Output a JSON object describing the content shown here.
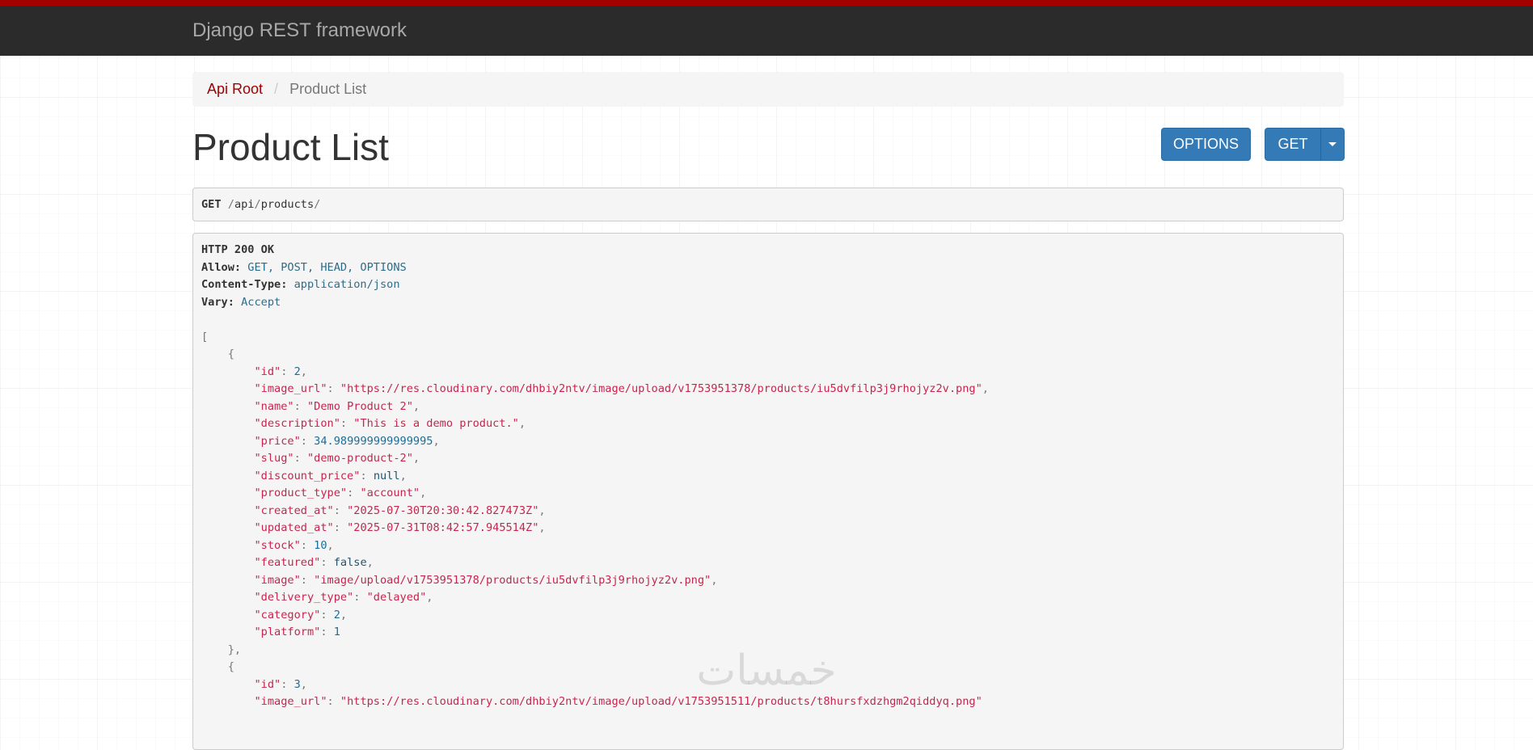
{
  "navbar": {
    "brand": "Django REST framework"
  },
  "breadcrumb": {
    "root": "Api Root",
    "separator": "/",
    "current": "Product List"
  },
  "page": {
    "title": "Product List"
  },
  "buttons": {
    "options": "OPTIONS",
    "get": "GET"
  },
  "request": {
    "method": "GET",
    "path_parts": [
      "/",
      "api",
      "/",
      "products",
      "/"
    ]
  },
  "response": {
    "status": "HTTP 200 OK",
    "headers": [
      {
        "name": "Allow:",
        "value": "GET, POST, HEAD, OPTIONS"
      },
      {
        "name": "Content-Type:",
        "value": "application/json"
      },
      {
        "name": "Vary:",
        "value": "Accept"
      }
    ],
    "items": [
      {
        "fields": [
          {
            "key": "id",
            "value": "2",
            "type": "num"
          },
          {
            "key": "image_url",
            "value": "\"https://res.cloudinary.com/dhbiy2ntv/image/upload/v1753951378/products/iu5dvfilp3j9rhojyz2v.png\"",
            "type": "str"
          },
          {
            "key": "name",
            "value": "\"Demo Product 2\"",
            "type": "str"
          },
          {
            "key": "description",
            "value": "\"This is a demo product.\"",
            "type": "str"
          },
          {
            "key": "price",
            "value": "34.989999999999995",
            "type": "num"
          },
          {
            "key": "slug",
            "value": "\"demo-product-2\"",
            "type": "str"
          },
          {
            "key": "discount_price",
            "value": "null",
            "type": "lit"
          },
          {
            "key": "product_type",
            "value": "\"account\"",
            "type": "str"
          },
          {
            "key": "created_at",
            "value": "\"2025-07-30T20:30:42.827473Z\"",
            "type": "str"
          },
          {
            "key": "updated_at",
            "value": "\"2025-07-31T08:42:57.945514Z\"",
            "type": "str"
          },
          {
            "key": "stock",
            "value": "10",
            "type": "num"
          },
          {
            "key": "featured",
            "value": "false",
            "type": "lit"
          },
          {
            "key": "image",
            "value": "\"image/upload/v1753951378/products/iu5dvfilp3j9rhojyz2v.png\"",
            "type": "str"
          },
          {
            "key": "delivery_type",
            "value": "\"delayed\"",
            "type": "str"
          },
          {
            "key": "category",
            "value": "2",
            "type": "num"
          },
          {
            "key": "platform",
            "value": "1",
            "type": "num"
          }
        ]
      },
      {
        "fields": [
          {
            "key": "id",
            "value": "3",
            "type": "num"
          },
          {
            "key": "image_url",
            "value": "\"https://res.cloudinary.com/dhbiy2ntv/image/upload/v1753951511/products/t8hursfxdzhgm2qiddyq.png\"",
            "type": "str"
          }
        ]
      }
    ]
  },
  "watermark": "خمسات"
}
